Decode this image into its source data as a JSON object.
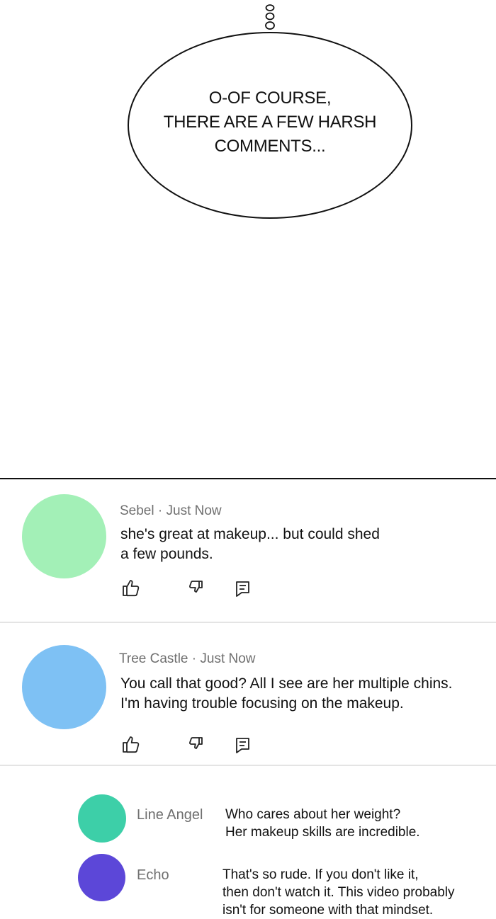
{
  "bubble": {
    "text": "O-OF COURSE,\nTHERE ARE A FEW HARSH\nCOMMENTS..."
  },
  "comments": [
    {
      "author": "Sebel",
      "time": "Just Now",
      "text_line1": "she's great at makeup... but could shed",
      "text_line2": "a few pounds.",
      "avatar_color": "#a3f0b7"
    },
    {
      "author": "Tree Castle",
      "time": "Just Now",
      "text_line1": "You call that good? All I see are her multiple chins.",
      "text_line2": "I'm having trouble focusing on the makeup.",
      "avatar_color": "#7ec1f4"
    }
  ],
  "replies": [
    {
      "author": "Line Angel",
      "text": "Who cares about her weight?\nHer makeup skills are incredible.",
      "avatar_color": "#3dcfa8"
    },
    {
      "author": "Echo",
      "text": "That's so rude. If you don't like it,\nthen don't watch it. This video probably\nisn't for someone with that mindset.",
      "avatar_color": "#5c47d8"
    }
  ],
  "meta_separator": " · ",
  "icons": [
    "thumbs-up-icon",
    "thumbs-down-icon",
    "reply-icon"
  ]
}
